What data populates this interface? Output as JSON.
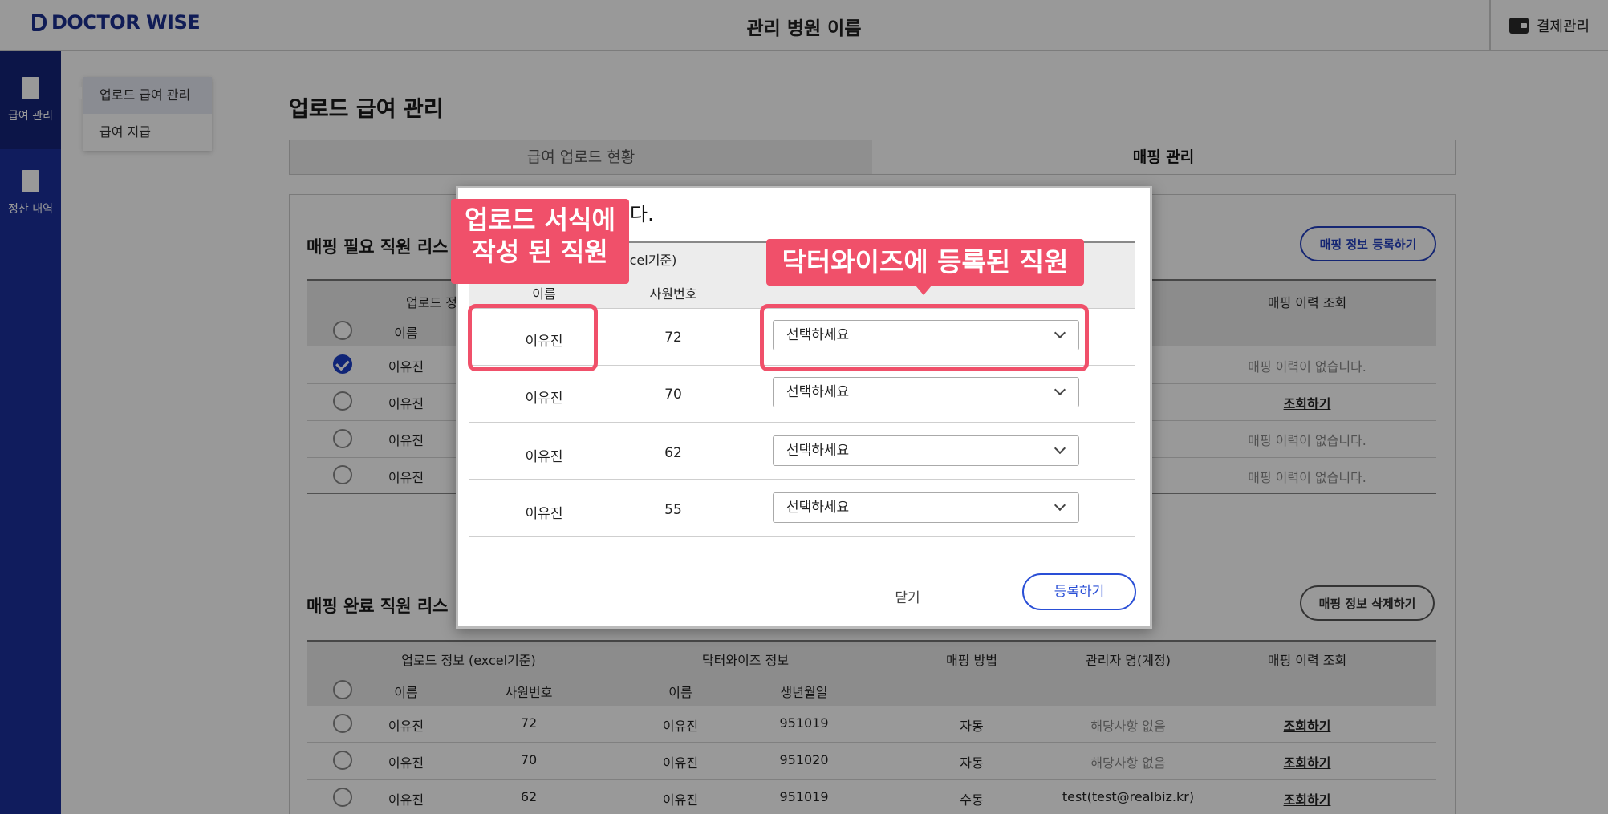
{
  "header": {
    "logo_text": "DOCTOR WISE",
    "title": "관리 병원 이름",
    "billing_label": "결제관리"
  },
  "sidebar": {
    "items": [
      {
        "label": "급여 관리",
        "active": true
      },
      {
        "label": "정산 내역",
        "active": false
      }
    ],
    "flyout": [
      "업로드 급여 관리",
      "급여 지급"
    ]
  },
  "page": {
    "heading": "업로드 급여 관리",
    "tabs": [
      "급여 업로드 현황",
      "매핑 관리"
    ],
    "active_tab": 1
  },
  "mapping_needed": {
    "title": "매핑 필요 직원 리스",
    "register_button": "매핑 정보 등록하기",
    "group_header": "업로드 정",
    "name_header": "이름",
    "history_header": "매핑 이력 조회",
    "rows": [
      {
        "name": "이유진",
        "checked": true,
        "history": "매핑 이력이 없습니다.",
        "history_is_link": false
      },
      {
        "name": "이유진",
        "checked": false,
        "history": "조회하기",
        "history_is_link": true
      },
      {
        "name": "이유진",
        "checked": false,
        "history": "매핑 이력이 없습니다.",
        "history_is_link": false
      },
      {
        "name": "이유진",
        "checked": false,
        "history": "매핑 이력이 없습니다.",
        "history_is_link": false
      }
    ]
  },
  "mapping_done": {
    "title": "매핑 완료 직원 리스",
    "delete_button": "매핑 정보 삭제하기",
    "headers": {
      "upload_group": "업로드 정보 (excel기준)",
      "dw_group": "닥터와이즈 정보",
      "method": "매핑 방법",
      "admin": "관리자 명(계정)",
      "history": "매핑 이력 조회",
      "name": "이름",
      "emp_no": "사원번호",
      "dw_name": "이름",
      "birth": "생년월일"
    },
    "rows": [
      {
        "name": "이유진",
        "emp_no": "72",
        "dw_name": "이유진",
        "birth": "951019",
        "method": "자동",
        "admin": "해당사항 없음",
        "admin_muted": true,
        "history": "조회하기"
      },
      {
        "name": "이유진",
        "emp_no": "70",
        "dw_name": "이유진",
        "birth": "951020",
        "method": "자동",
        "admin": "해당사항 없음",
        "admin_muted": true,
        "history": "조회하기"
      },
      {
        "name": "이유진",
        "emp_no": "62",
        "dw_name": "이유진",
        "birth": "951019",
        "method": "수동",
        "admin": "test(test@realbiz.kr)",
        "admin_muted": false,
        "history": "조회하기"
      }
    ]
  },
  "modal": {
    "title_visible": "다.",
    "subheader_visible": "cel기준)",
    "col_name": "이름",
    "col_emp_no": "사원번호",
    "select_placeholder": "선택하세요",
    "rows": [
      {
        "name": "이유진",
        "emp_no": "72"
      },
      {
        "name": "이유진",
        "emp_no": "70"
      },
      {
        "name": "이유진",
        "emp_no": "62"
      },
      {
        "name": "이유진",
        "emp_no": "55"
      }
    ],
    "close_label": "닫기",
    "register_label": "등록하기"
  },
  "annotations": {
    "left_line1": "업로드 서식에",
    "left_line2": "작성 된 직원",
    "right": "닥터와이즈에 등록된 직원",
    "color": "#f0506a"
  },
  "colors": {
    "brand": "#1b2f9c",
    "accent": "#2440c0"
  }
}
